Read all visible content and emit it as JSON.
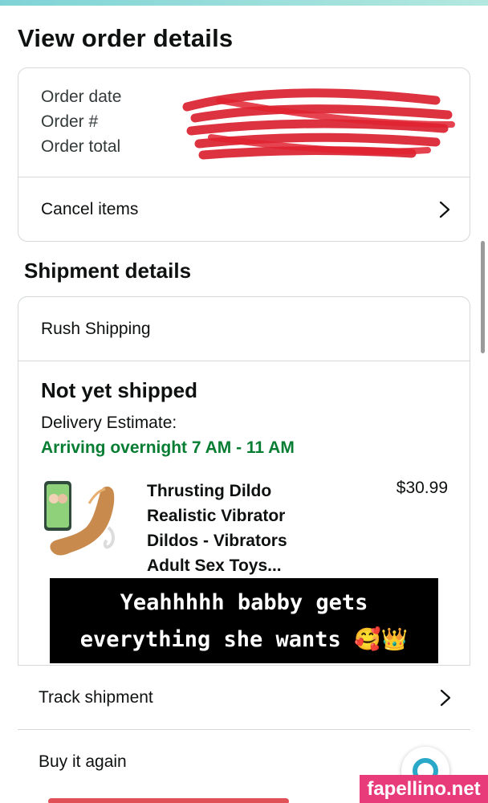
{
  "page": {
    "title": "View order details"
  },
  "order_summary": {
    "labels": [
      "Order date",
      "Order #",
      "Order total"
    ],
    "cancel_label": "Cancel items"
  },
  "shipment": {
    "section_title": "Shipment details",
    "shipping_method": "Rush Shipping",
    "status": "Not yet shipped",
    "estimate_label": "Delivery Estimate:",
    "arrival": "Arriving overnight 7 AM - 11 AM",
    "arrival_color": "#067d32",
    "product": {
      "title_lines": [
        "Thrusting Dildo",
        "Realistic Vibrator",
        "Dildos - Vibrators",
        "Adult Sex Toys..."
      ],
      "price": "$30.99"
    }
  },
  "caption": {
    "line1": "Yeahhhhh babby gets",
    "line2": "everything she wants",
    "emojis": "🥰👑"
  },
  "actions": {
    "track_label": "Track shipment",
    "buy_again_label": "Buy it again"
  },
  "watermark": "fapellino.net",
  "icons": {
    "chevron": "chevron-right-icon",
    "redaction": "red-scribble",
    "fab": "assistant-fab-icon"
  }
}
